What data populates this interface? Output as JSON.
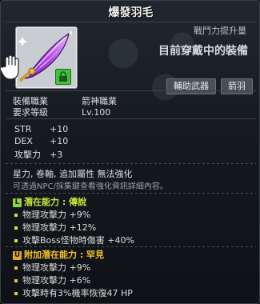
{
  "item": {
    "name": "爆發羽毛",
    "combat_power_label": "戰鬥力提升量",
    "equipped_label": "目前穿戴中的裝備",
    "tags": [
      "輔助武器",
      "箭羽"
    ]
  },
  "requirements": {
    "job_label": "裝備職業",
    "job_value": "箭神職業",
    "level_label": "要求等級",
    "level_value": "Lv.100"
  },
  "stats": [
    {
      "name": "STR",
      "value": "+10"
    },
    {
      "name": "DEX",
      "value": "+10"
    },
    {
      "name": "攻擊力",
      "value": "+3"
    }
  ],
  "info": {
    "line1": "星力, 卷軸, 追加屬性 無法強化",
    "line2": "可透過NPC/採集鍵查看強化資訊詳細內容。"
  },
  "potential": {
    "header": "潛在能力 : 傳說",
    "icon_letter": "L",
    "color": "#c8e83a",
    "lines": [
      "物理攻擊力 +9%",
      "物理攻擊力 +12%",
      "攻擊Boss怪物時傷害 +40%"
    ]
  },
  "additional_potential": {
    "header": "附加潛在能力 : 罕見",
    "icon_letter": "U",
    "color": "#f2c12e",
    "lines": [
      "物理攻擊力 +9%",
      "物理攻擊力 +6%",
      "攻擊時有3%機率恢復47 HP"
    ]
  },
  "icons": {
    "item_icon": "purple-feather-icon",
    "potential_badge": "green-potential-lock-icon",
    "cursor": "hand-cursor-icon"
  }
}
